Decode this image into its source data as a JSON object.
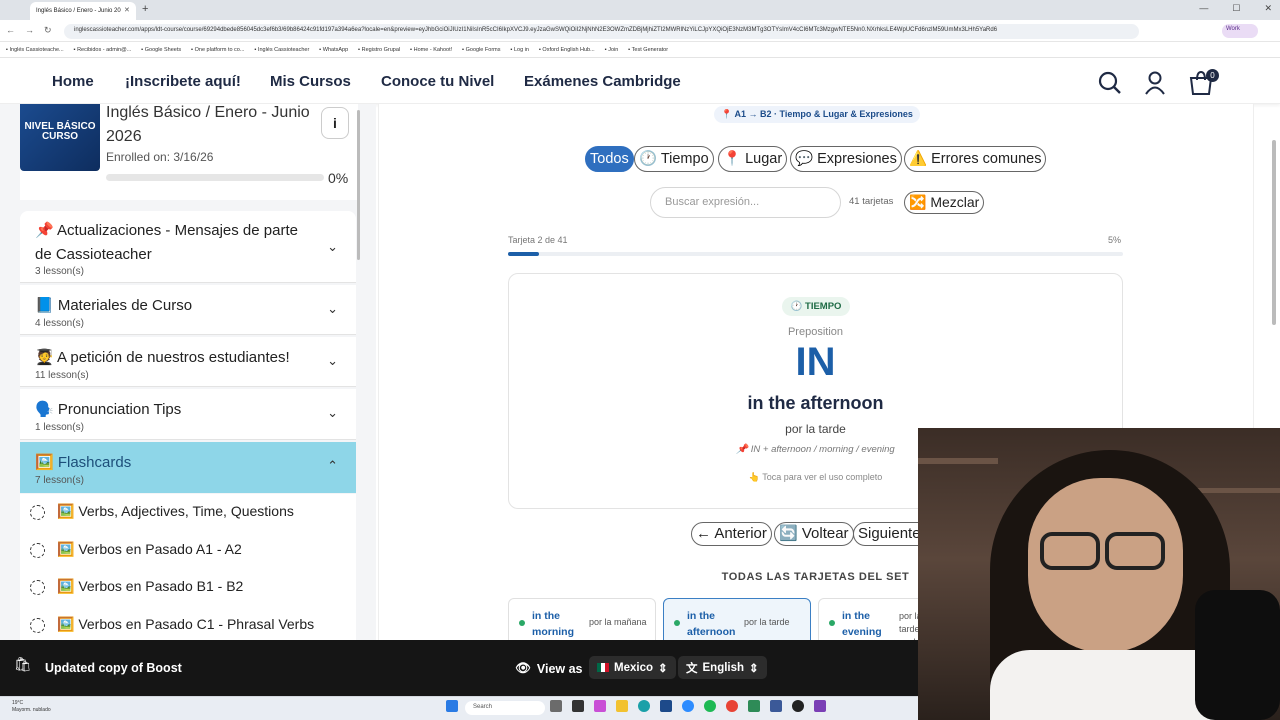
{
  "browser": {
    "tab_title": "Inglés Básico / Enero - Junio 20",
    "url": "inglescassioteacher.com/apps/ldt-course/course/69294dbede856045dc3ef6b3/69b86424c91fd197a394a6ea?locale=en&preview=eyJhbGciOiJIUzI1NiIsInR5cCI6IkpXVCJ9.eyJzaGwSWQiOiI2NjNhN2E3OWZmZDBjMjhiZTI2MWRlNzYiLCJpYXQiOjE3NzM3MTg3OTYsImV4cCI6MTc3MzgwNTE5Nn0.NXrhksLE4WpUCFd6nzlM59UmMx3LHh5YaRd6",
    "profile_label": "Work",
    "bookmarks": [
      "Inglés Cassioteache...",
      "Recibidos - admin@...",
      "Google Sheets",
      "One platform to co...",
      "Inglés Cassioteacher",
      "WhatsApp",
      "Registro Grupal",
      "Home - Kahoot!",
      "Google Forms",
      "Log in",
      "Oxford English Hub...",
      "Join",
      "Test Generator"
    ]
  },
  "header": {
    "nav": [
      "Home",
      "¡Inscribete aquí!",
      "Mis Cursos",
      "Conoce tu Nivel",
      "Exámenes Cambridge"
    ],
    "cart_count": "0"
  },
  "course": {
    "thumb_text": "NIVEL BÁSICO CURSO",
    "title": "Inglés Básico / Enero - Junio 2026",
    "enrolled": "Enrolled on: 3/16/26",
    "progress": "0%",
    "info_icon": "i"
  },
  "sections": [
    {
      "title": "📌 Actualizaciones - Mensajes de parte de Cassioteacher",
      "sub": "3 lesson(s)"
    },
    {
      "title": "📘 Materiales de Curso",
      "sub": "4 lesson(s)"
    },
    {
      "title": "🧑‍🎓 A petición de nuestros estudiantes!",
      "sub": "11 lesson(s)"
    },
    {
      "title": "🗣️ Pronunciation Tips",
      "sub": "1 lesson(s)"
    },
    {
      "title": "🖼️ Flashcards",
      "sub": "7 lesson(s)"
    }
  ],
  "lessons": [
    "🖼️ Verbs, Adjectives, Time, Questions",
    "🖼️ Verbos en Pasado A1 - A2",
    "🖼️ Verbos en Pasado B1 - B2",
    "🖼️ Verbos en Pasado C1 - Phrasal Verbs"
  ],
  "flashcards": {
    "level_badge": "📍 A1 → B2 · Tiempo & Lugar & Expresiones",
    "filters": [
      "Todos",
      "🕐 Tiempo",
      "📍 Lugar",
      "💬 Expresiones",
      "⚠️ Errores comunes"
    ],
    "search_placeholder": "Buscar expresión...",
    "count": "41 tarjetas",
    "shuffle": "🔀 Mezclar",
    "progress_label": "Tarjeta 2 de 41",
    "progress_pct": "5%",
    "progress_value": 0.05,
    "card": {
      "category": "🕐 TIEMPO",
      "pos": "Preposition",
      "word": "IN",
      "phrase": "in the afternoon",
      "translation": "por la tarde",
      "rule": "📌 IN + afternoon / morning / evening",
      "hint": "👆 Toca para ver el uso completo"
    },
    "buttons": [
      "← Anterior",
      "🔄 Voltear",
      "Siguiente →"
    ],
    "all_cards_title": "TODAS LAS TARJETAS DEL SET",
    "mini_cards": [
      {
        "en": "in the morning",
        "es": "por la mañana"
      },
      {
        "en": "in the afternoon",
        "es": "por la tarde"
      },
      {
        "en": "in the evening",
        "es": "por la tarde / noche"
      }
    ]
  },
  "boost": {
    "label": "Updated copy of Boost",
    "view_as": "View as",
    "country": "Mexico",
    "language": "English"
  },
  "taskbar": {
    "weather_temp": "19°C",
    "weather_desc": "Mayorm. nublado",
    "search": "Search"
  },
  "colors": {
    "accent": "#1c5fa8",
    "flashcards_active": "#8ed6e8",
    "todos_active": "#2f6fbf"
  }
}
